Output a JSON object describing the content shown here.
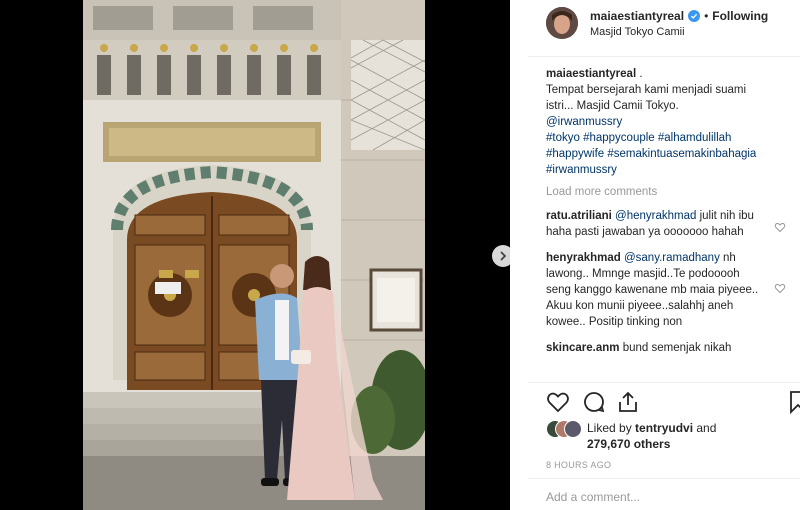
{
  "post": {
    "username": "maiaestiantyreal",
    "verified_icon": "verified-badge-icon",
    "separator": "•",
    "follow_status": "Following",
    "location": "Masjid Tokyo Camii"
  },
  "caption": {
    "username": "maiaestiantyreal",
    "username_suffix": " .",
    "lines": [
      "Tempat bersejarah kami menjadi suami",
      "istri... Masjid Camii Tokyo."
    ],
    "mention": "@irwanmussry",
    "hashtag_lines": [
      "#tokyo #happycouple #alhamdulillah",
      "#happywife #semakintuasemakinbahagia",
      "#irwanmussry"
    ]
  },
  "load_more": "Load more comments",
  "comments": [
    {
      "username": "ratu.atriliani",
      "mention": "@henyrakhmad",
      "text": " julit nih ibu haha pasti jawaban ya ooooooo hahah"
    },
    {
      "username": "henyrakhmad",
      "mention": "@sany.ramadhany",
      "text": " nh lawong.. Mmnge masjid..Te podooooh seng kanggo kawenane mb maia piyeee.. Akuu kon munii piyeee..salahhj aneh kowee.. Positip tinking non"
    },
    {
      "username": "skincare.anm",
      "mention": "",
      "text": " bund semenjak nikah"
    }
  ],
  "likes": {
    "prefix": "Liked by ",
    "user": "tentryudvi",
    "middle": " and",
    "count": "279,670 others"
  },
  "timestamp": "8 HOURS AGO",
  "add_comment_placeholder": "Add a comment...",
  "colors": {
    "link": "#003569",
    "muted": "#999999",
    "verified": "#3897f0"
  }
}
